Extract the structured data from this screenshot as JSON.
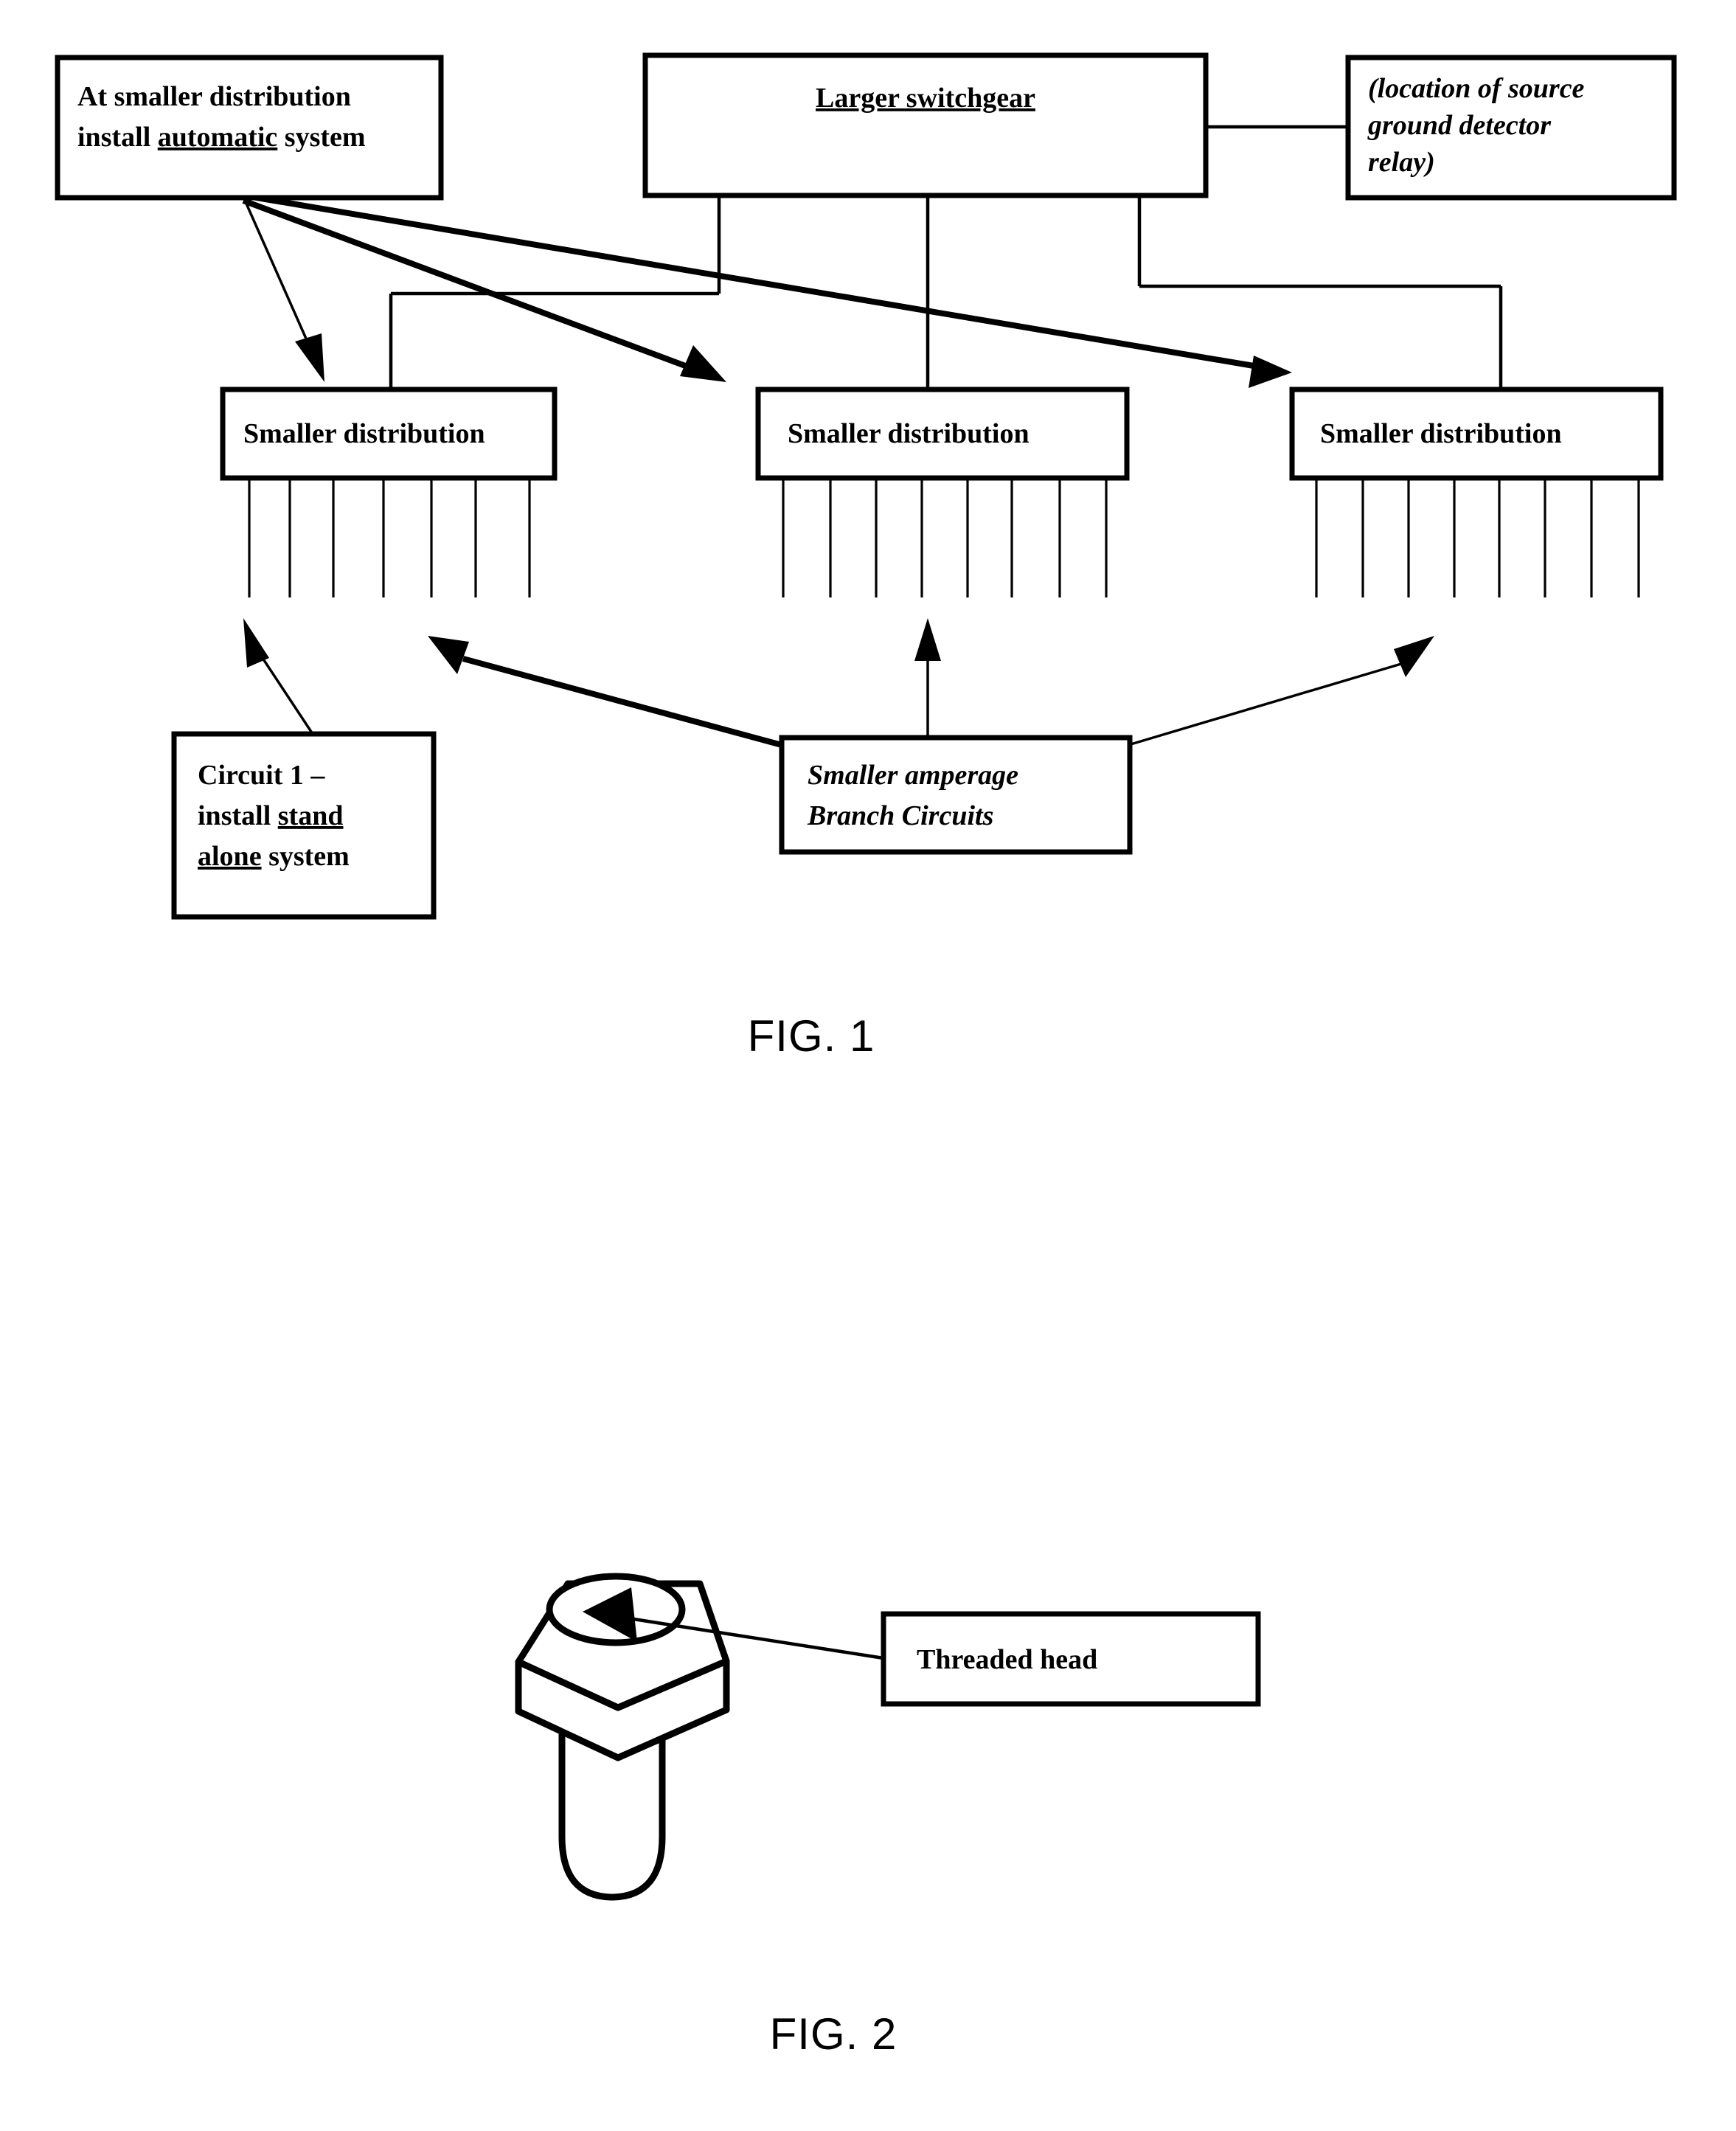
{
  "document": {
    "type": "patent-figure-sheet",
    "background_color": "#ffffff",
    "ink_color": "#000000"
  },
  "figures": [
    {
      "id": "fig1",
      "label": "FIG. 1",
      "caption_position": "bottom-center",
      "boxes": [
        {
          "id": "auto-system",
          "name": "at-smaller-distribution-box",
          "lines": [
            {
              "segments": [
                {
                  "text": "At smaller distribution",
                  "underline": false
                }
              ]
            },
            {
              "segments": [
                {
                  "text": "install ",
                  "underline": false
                },
                {
                  "text": "automatic",
                  "underline": true
                },
                {
                  "text": " system",
                  "underline": false
                }
              ]
            }
          ],
          "align": "left",
          "italic": false
        },
        {
          "id": "larger-switchgear",
          "name": "larger-switchgear-box",
          "lines": [
            {
              "segments": [
                {
                  "text": "Larger switchgear",
                  "underline": true
                }
              ]
            }
          ],
          "align": "center",
          "italic": false
        },
        {
          "id": "ground-relay",
          "name": "ground-detector-relay-box",
          "lines": [
            {
              "segments": [
                {
                  "text": "(location of source",
                  "underline": false
                }
              ]
            },
            {
              "segments": [
                {
                  "text": "ground detector",
                  "underline": false
                }
              ]
            },
            {
              "segments": [
                {
                  "text": "relay)",
                  "underline": false
                }
              ]
            }
          ],
          "align": "left",
          "italic": true
        },
        {
          "id": "smaller-dist-1",
          "name": "smaller-distribution-box-left",
          "lines": [
            {
              "segments": [
                {
                  "text": "Smaller distribution",
                  "underline": false
                }
              ]
            }
          ],
          "align": "left",
          "italic": false,
          "branch_circuits": 7
        },
        {
          "id": "smaller-dist-2",
          "name": "smaller-distribution-box-center",
          "lines": [
            {
              "segments": [
                {
                  "text": "Smaller distribution",
                  "underline": false
                }
              ]
            }
          ],
          "align": "left",
          "italic": false,
          "branch_circuits": 8
        },
        {
          "id": "smaller-dist-3",
          "name": "smaller-distribution-box-right",
          "lines": [
            {
              "segments": [
                {
                  "text": "Smaller distribution",
                  "underline": false
                }
              ]
            }
          ],
          "align": "left",
          "italic": false,
          "branch_circuits": 8
        },
        {
          "id": "circuit-1",
          "name": "circuit-1-stand-alone-box",
          "lines": [
            {
              "segments": [
                {
                  "text": "Circuit 1 –",
                  "underline": false
                }
              ]
            },
            {
              "segments": [
                {
                  "text": "install ",
                  "underline": false
                },
                {
                  "text": "stand",
                  "underline": true
                }
              ]
            },
            {
              "segments": [
                {
                  "text": "alone",
                  "underline": true
                },
                {
                  "text": " system",
                  "underline": false
                }
              ]
            }
          ],
          "align": "left",
          "italic": false
        },
        {
          "id": "branch-circuits",
          "name": "smaller-amperage-branch-circuits-box",
          "lines": [
            {
              "segments": [
                {
                  "text": "Smaller amperage",
                  "underline": false
                }
              ]
            },
            {
              "segments": [
                {
                  "text": "Branch Circuits",
                  "underline": false
                }
              ]
            }
          ],
          "align": "left",
          "italic": true
        }
      ],
      "connections": [
        {
          "from": "auto-system",
          "to": "smaller-dist-1",
          "style": "arrow-thin"
        },
        {
          "from": "auto-system",
          "to": "smaller-dist-2",
          "style": "arrow-thick"
        },
        {
          "from": "auto-system",
          "to": "smaller-dist-3",
          "style": "arrow-thick"
        },
        {
          "from": "ground-relay",
          "to": "larger-switchgear",
          "style": "arrow-horizontal-left"
        },
        {
          "from": "larger-switchgear",
          "to": "smaller-dist-1",
          "style": "bus-line"
        },
        {
          "from": "larger-switchgear",
          "to": "smaller-dist-2",
          "style": "bus-line"
        },
        {
          "from": "larger-switchgear",
          "to": "smaller-dist-3",
          "style": "bus-line"
        },
        {
          "from": "circuit-1",
          "to": "smaller-dist-1-branch",
          "style": "arrow-thin"
        },
        {
          "from": "branch-circuits",
          "to": "smaller-dist-1-branch",
          "style": "arrow-thick"
        },
        {
          "from": "branch-circuits",
          "to": "smaller-dist-2-branch",
          "style": "arrow-thin"
        },
        {
          "from": "branch-circuits",
          "to": "smaller-dist-3-branch",
          "style": "arrow-thin"
        }
      ]
    },
    {
      "id": "fig2",
      "label": "FIG. 2",
      "caption_position": "bottom-center",
      "illustration": "bolt-with-hex-head-and-circular-recess",
      "boxes": [
        {
          "id": "threaded-head",
          "name": "threaded-head-box",
          "lines": [
            {
              "segments": [
                {
                  "text": "Threaded head",
                  "underline": false
                }
              ]
            }
          ],
          "align": "left",
          "italic": false
        }
      ],
      "connections": [
        {
          "from": "threaded-head",
          "to": "bolt-recess",
          "style": "arrow-horizontal-left"
        }
      ]
    }
  ],
  "fig1": {
    "label": "FIG. 1",
    "box_auto_line1": "At smaller distribution",
    "box_auto_line2_pre": "install ",
    "box_auto_line2_ul": "automatic",
    "box_auto_line2_post": " system",
    "box_switchgear": "Larger switchgear",
    "box_relay_line1": "(location of source",
    "box_relay_line2": "ground detector",
    "box_relay_line3": "relay)",
    "box_dist_left": "Smaller distribution",
    "box_dist_center": "Smaller distribution",
    "box_dist_right": "Smaller distribution",
    "box_circuit1_line1": "Circuit 1 –",
    "box_circuit1_line2_pre": "install ",
    "box_circuit1_line2_ul": "stand",
    "box_circuit1_line3_ul": "alone",
    "box_circuit1_line3_post": " system",
    "box_branch_line1": "Smaller amperage",
    "box_branch_line2": "Branch Circuits"
  },
  "fig2": {
    "label": "FIG. 2",
    "box_threaded_head": "Threaded head"
  }
}
